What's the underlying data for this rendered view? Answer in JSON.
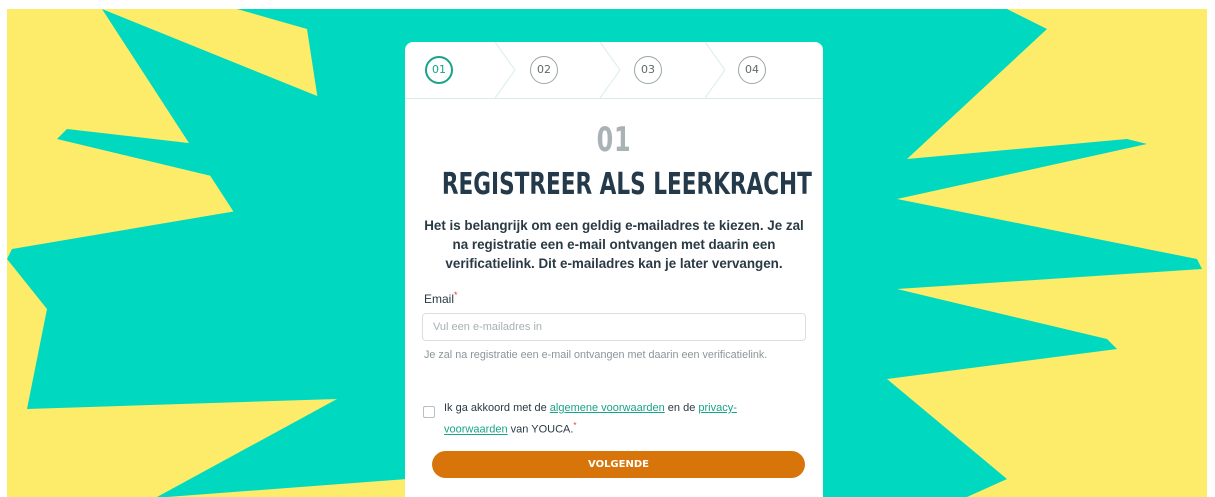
{
  "colors": {
    "background": "#fcec6a",
    "burst": "#00d9bf",
    "accent": "#18a487",
    "button": "#d8750a",
    "heading": "#243a4a"
  },
  "stepper": {
    "steps": [
      "01",
      "02",
      "03",
      "04"
    ],
    "active_step": "01"
  },
  "form": {
    "step_number": "01",
    "title": "REGISTREER ALS LEERKRACHT",
    "intro": "Het is belangrijk om een geldig e-mailadres te kiezen. Je zal na registratie een e-mail ontvangen met daarin een verificatielink. Dit e-mailadres kan je later vervangen.",
    "email_label": "Email",
    "required_mark": "*",
    "email_value": "",
    "email_placeholder": "Vul een e-mailadres in",
    "email_hint": "Je zal na registratie een e-mail ontvangen met daarin een verificatielink.",
    "agree_prefix": "Ik ga akkoord met de ",
    "agree_link_terms": "algemene voorwaarden",
    "agree_middle": " en de ",
    "agree_link_privacy": "privacy-voorwaarden",
    "agree_suffix": " van YOUCA.",
    "agree_checked": false,
    "submit_label": "VOLGENDE"
  }
}
